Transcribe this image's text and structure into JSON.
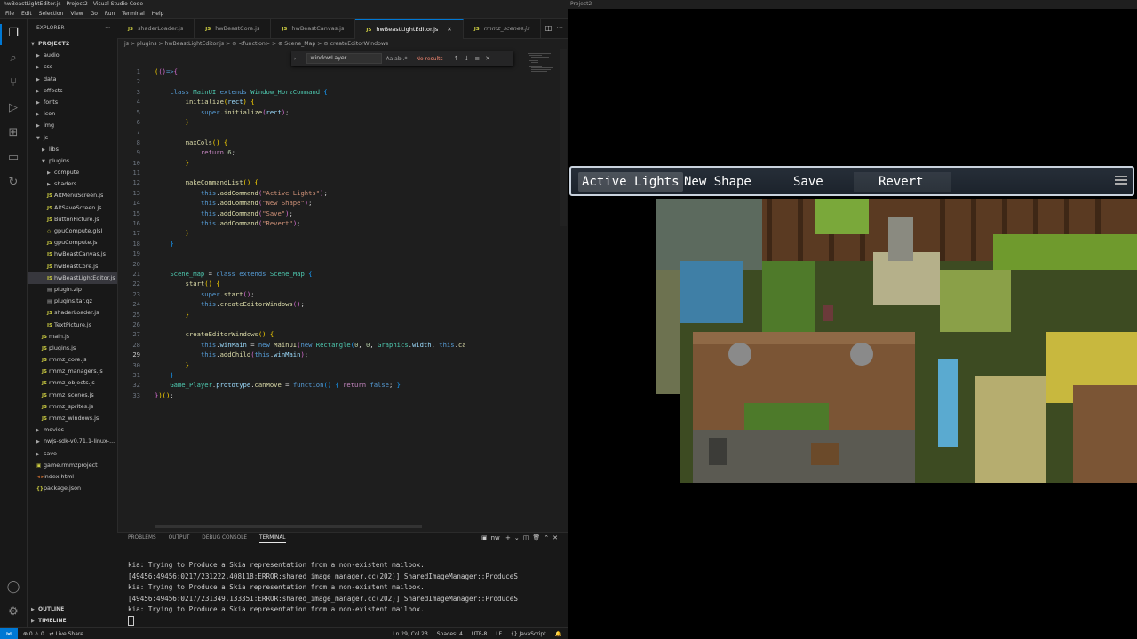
{
  "window_title": "hwBeastLightEditor.js - Project2 - Visual Studio Code",
  "menu": [
    "File",
    "Edit",
    "Selection",
    "View",
    "Go",
    "Run",
    "Terminal",
    "Help"
  ],
  "explorer": {
    "header": "EXPLORER",
    "project": "PROJECT2",
    "items": [
      {
        "label": "audio",
        "type": "folder",
        "depth": 1,
        "open": false
      },
      {
        "label": "css",
        "type": "folder",
        "depth": 1,
        "open": false
      },
      {
        "label": "data",
        "type": "folder",
        "depth": 1,
        "open": false
      },
      {
        "label": "effects",
        "type": "folder",
        "depth": 1,
        "open": false
      },
      {
        "label": "fonts",
        "type": "folder",
        "depth": 1,
        "open": false
      },
      {
        "label": "icon",
        "type": "folder",
        "depth": 1,
        "open": false
      },
      {
        "label": "img",
        "type": "folder",
        "depth": 1,
        "open": false
      },
      {
        "label": "js",
        "type": "folder",
        "depth": 1,
        "open": true
      },
      {
        "label": "libs",
        "type": "folder",
        "depth": 2,
        "open": false
      },
      {
        "label": "plugins",
        "type": "folder",
        "depth": 2,
        "open": true
      },
      {
        "label": "compute",
        "type": "folder",
        "depth": 3,
        "open": false
      },
      {
        "label": "shaders",
        "type": "folder",
        "depth": 3,
        "open": false
      },
      {
        "label": "AltMenuScreen.js",
        "type": "js",
        "depth": 3
      },
      {
        "label": "AltSaveScreen.js",
        "type": "js",
        "depth": 3
      },
      {
        "label": "ButtonPicture.js",
        "type": "js",
        "depth": 3
      },
      {
        "label": "gpuCompute.glsl",
        "type": "glsl",
        "depth": 3
      },
      {
        "label": "gpuCompute.js",
        "type": "js",
        "depth": 3
      },
      {
        "label": "hwBeastCanvas.js",
        "type": "js",
        "depth": 3
      },
      {
        "label": "hwBeastCore.js",
        "type": "js",
        "depth": 3
      },
      {
        "label": "hwBeastLightEditor.js",
        "type": "js",
        "depth": 3,
        "selected": true
      },
      {
        "label": "plugin.zip",
        "type": "zip",
        "depth": 3
      },
      {
        "label": "plugins.tar.gz",
        "type": "zip",
        "depth": 3
      },
      {
        "label": "shaderLoader.js",
        "type": "js",
        "depth": 3
      },
      {
        "label": "TextPicture.js",
        "type": "js",
        "depth": 3
      },
      {
        "label": "main.js",
        "type": "js",
        "depth": 2
      },
      {
        "label": "plugins.js",
        "type": "js",
        "depth": 2
      },
      {
        "label": "rmmz_core.js",
        "type": "js",
        "depth": 2
      },
      {
        "label": "rmmz_managers.js",
        "type": "js",
        "depth": 2
      },
      {
        "label": "rmmz_objects.js",
        "type": "js",
        "depth": 2
      },
      {
        "label": "rmmz_scenes.js",
        "type": "js",
        "depth": 2
      },
      {
        "label": "rmmz_sprites.js",
        "type": "js",
        "depth": 2
      },
      {
        "label": "rmmz_windows.js",
        "type": "js",
        "depth": 2
      },
      {
        "label": "movies",
        "type": "folder",
        "depth": 1,
        "open": false
      },
      {
        "label": "nwjs-sdk-v0.71.1-linux-...",
        "type": "folder",
        "depth": 1,
        "open": false
      },
      {
        "label": "save",
        "type": "folder",
        "depth": 1,
        "open": false
      },
      {
        "label": "game.rmmzproject",
        "type": "proj",
        "depth": 1
      },
      {
        "label": "index.html",
        "type": "html",
        "depth": 1
      },
      {
        "label": "package.json",
        "type": "json",
        "depth": 1
      }
    ],
    "outline": "OUTLINE",
    "timeline": "TIMELINE"
  },
  "tabs": [
    {
      "label": "shaderLoader.js",
      "active": false,
      "italic": false
    },
    {
      "label": "hwBeastCore.js",
      "active": false,
      "italic": false
    },
    {
      "label": "hwBeastCanvas.js",
      "active": false,
      "italic": false
    },
    {
      "label": "hwBeastLightEditor.js",
      "active": true,
      "italic": false
    },
    {
      "label": "rmmz_scenes.js",
      "active": false,
      "italic": true
    }
  ],
  "breadcrumb": "js > plugins > hwBeastLightEditor.js > ⊙ <function> > ⊛ Scene_Map > ⊙ createEditorWindows",
  "find": {
    "value": "windowLayer",
    "options": "Aa  ab  .*",
    "result": "No results"
  },
  "code": [
    {
      "n": "1",
      "h": "<span class='br1'>(</span><span class='br2'>(</span><span class='br2'>)</span><span class='k'>=></span><span class='br2'>{</span>"
    },
    {
      "n": "2",
      "h": ""
    },
    {
      "n": "3",
      "h": "    <span class='k'>class</span> <span class='cls'>MainUI</span> <span class='k'>extends</span> <span class='cls'>Window_HorzCommand</span> <span class='br3'>{</span>"
    },
    {
      "n": "4",
      "h": "        <span class='fn'>initialize</span><span class='br1'>(</span><span class='var'>rect</span><span class='br1'>)</span> <span class='br1'>{</span>"
    },
    {
      "n": "5",
      "h": "            <span class='k'>super</span>.<span class='fn'>initialize</span><span class='br2'>(</span><span class='var'>rect</span><span class='br2'>)</span>;"
    },
    {
      "n": "6",
      "h": "        <span class='br1'>}</span>"
    },
    {
      "n": "7",
      "h": ""
    },
    {
      "n": "8",
      "h": "        <span class='fn'>maxCols</span><span class='br1'>()</span> <span class='br1'>{</span>"
    },
    {
      "n": "9",
      "h": "            <span class='kw'>return</span> <span class='num'>6</span>;"
    },
    {
      "n": "10",
      "h": "        <span class='br1'>}</span>"
    },
    {
      "n": "11",
      "h": ""
    },
    {
      "n": "12",
      "h": "        <span class='fn'>makeCommandList</span><span class='br1'>()</span> <span class='br1'>{</span>"
    },
    {
      "n": "13",
      "h": "            <span class='k'>this</span>.<span class='fn'>addCommand</span><span class='br2'>(</span><span class='str'>\"Active Lights\"</span><span class='br2'>)</span>;"
    },
    {
      "n": "14",
      "h": "            <span class='k'>this</span>.<span class='fn'>addCommand</span><span class='br2'>(</span><span class='str'>\"New Shape\"</span><span class='br2'>)</span>;"
    },
    {
      "n": "15",
      "h": "            <span class='k'>this</span>.<span class='fn'>addCommand</span><span class='br2'>(</span><span class='str'>\"Save\"</span><span class='br2'>)</span>;"
    },
    {
      "n": "16",
      "h": "            <span class='k'>this</span>.<span class='fn'>addCommand</span><span class='br2'>(</span><span class='str'>\"Revert\"</span><span class='br2'>)</span>;"
    },
    {
      "n": "17",
      "h": "        <span class='br1'>}</span>"
    },
    {
      "n": "18",
      "h": "    <span class='br3'>}</span>"
    },
    {
      "n": "19",
      "h": ""
    },
    {
      "n": "20",
      "h": ""
    },
    {
      "n": "21",
      "h": "    <span class='cls'>Scene_Map</span> = <span class='k'>class</span> <span class='k'>extends</span> <span class='cls'>Scene_Map</span> <span class='br3'>{</span>"
    },
    {
      "n": "22",
      "h": "        <span class='fn'>start</span><span class='br1'>()</span> <span class='br1'>{</span>"
    },
    {
      "n": "23",
      "h": "            <span class='k'>super</span>.<span class='fn'>start</span><span class='br2'>()</span>;"
    },
    {
      "n": "24",
      "h": "            <span class='k'>this</span>.<span class='fn'>createEditorWindows</span><span class='br2'>()</span>;"
    },
    {
      "n": "25",
      "h": "        <span class='br1'>}</span>"
    },
    {
      "n": "26",
      "h": ""
    },
    {
      "n": "27",
      "h": "        <span class='fn'>createEditorWindows</span><span class='br1'>()</span> <span class='br1'>{</span>"
    },
    {
      "n": "28",
      "h": "            <span class='k'>this</span>.<span class='var'>winMain</span> = <span class='k'>new</span> <span class='fn'>MainUI</span><span class='br2'>(</span><span class='k'>new</span> <span class='cls'>Rectangle</span><span class='br3'>(</span><span class='num'>0</span>, <span class='num'>0</span>, <span class='cls'>Graphics</span>.<span class='var'>width</span>, <span class='k'>this</span>.<span class='fn'>ca</span>"
    },
    {
      "n": "29",
      "h": "            <span class='k'>this</span>.<span class='fn'>addChild</span><span class='br2'>(</span><span class='k'>this</span>.<span class='var'>winMain</span><span class='br2'>)</span>;",
      "current": true
    },
    {
      "n": "30",
      "h": "        <span class='br1'>}</span>"
    },
    {
      "n": "31",
      "h": "    <span class='br3'>}</span>"
    },
    {
      "n": "32",
      "h": "    <span class='cls'>Game_Player</span>.<span class='var'>prototype</span>.<span class='fn'>canMove</span> = <span class='k'>function</span><span class='br3'>()</span> <span class='br3'>{</span> <span class='kw'>return</span> <span class='k'>false</span>; <span class='br3'>}</span>"
    },
    {
      "n": "33",
      "h": "<span class='br2'>}</span><span class='br1'>)()</span>;"
    }
  ],
  "panel": {
    "tabs": [
      "PROBLEMS",
      "OUTPUT",
      "DEBUG CONSOLE",
      "TERMINAL"
    ],
    "active_tab": "TERMINAL",
    "terminal_shell": "nw",
    "terminal_lines": [
      "kia: Trying to Produce a Skia representation from a non-existent mailbox.",
      "[49456:49456:0217/231222.408118:ERROR:shared_image_manager.cc(202)] SharedImageManager::ProduceS",
      "kia: Trying to Produce a Skia representation from a non-existent mailbox.",
      "[49456:49456:0217/231349.133351:ERROR:shared_image_manager.cc(202)] SharedImageManager::ProduceS",
      "kia: Trying to Produce a Skia representation from a non-existent mailbox."
    ]
  },
  "statusbar": {
    "problems": "⊗ 0 ⚠ 0",
    "live_share": "Live Share",
    "position": "Ln 29, Col 23",
    "spaces": "Spaces: 4",
    "encoding": "UTF-8",
    "eol": "LF",
    "language": "{} JavaScript"
  },
  "game": {
    "window_title": "Project2",
    "commands": [
      "Active Lights",
      "New Shape",
      "Save",
      "Revert"
    ],
    "selected_command": "Active Lights"
  }
}
